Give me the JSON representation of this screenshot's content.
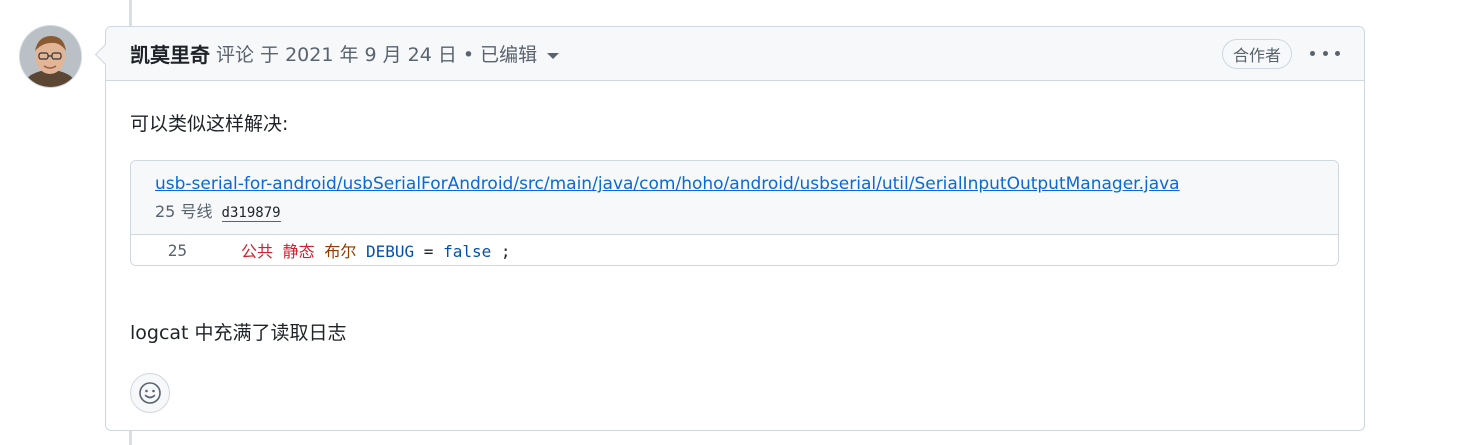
{
  "comment": {
    "author": "凯莫里奇",
    "meta": "评论 于 2021 年 9 月 24 日 • 已编辑",
    "role_badge": "合作者",
    "body_intro": "可以类似这样解决:",
    "body_outro": "logcat 中充满了读取日志"
  },
  "snippet": {
    "file_path": "usb-serial-for-android/usbSerialForAndroid/src/main/java/com/hoho/android/usbserial/util/SerialInputOutputManager.java",
    "line_label": "25 号线",
    "commit_sha": "d319879",
    "lines": [
      {
        "number": "25",
        "tokens": {
          "kw1": "公共",
          "kw2": "静态",
          "type": "布尔",
          "ident": "DEBUG",
          "op": "=",
          "lit": "false",
          "end": ";"
        }
      }
    ]
  },
  "icons": {
    "avatar": "user-avatar",
    "caret": "chevron-down-icon",
    "more": "kebab-horizontal-icon",
    "reaction": "smiley-icon"
  },
  "colors": {
    "link": "#0969da",
    "keyword": "#cf222e",
    "type": "#953800",
    "identifier": "#0550ae",
    "border": "#d0d7de",
    "header_bg": "#f6f8fa"
  }
}
